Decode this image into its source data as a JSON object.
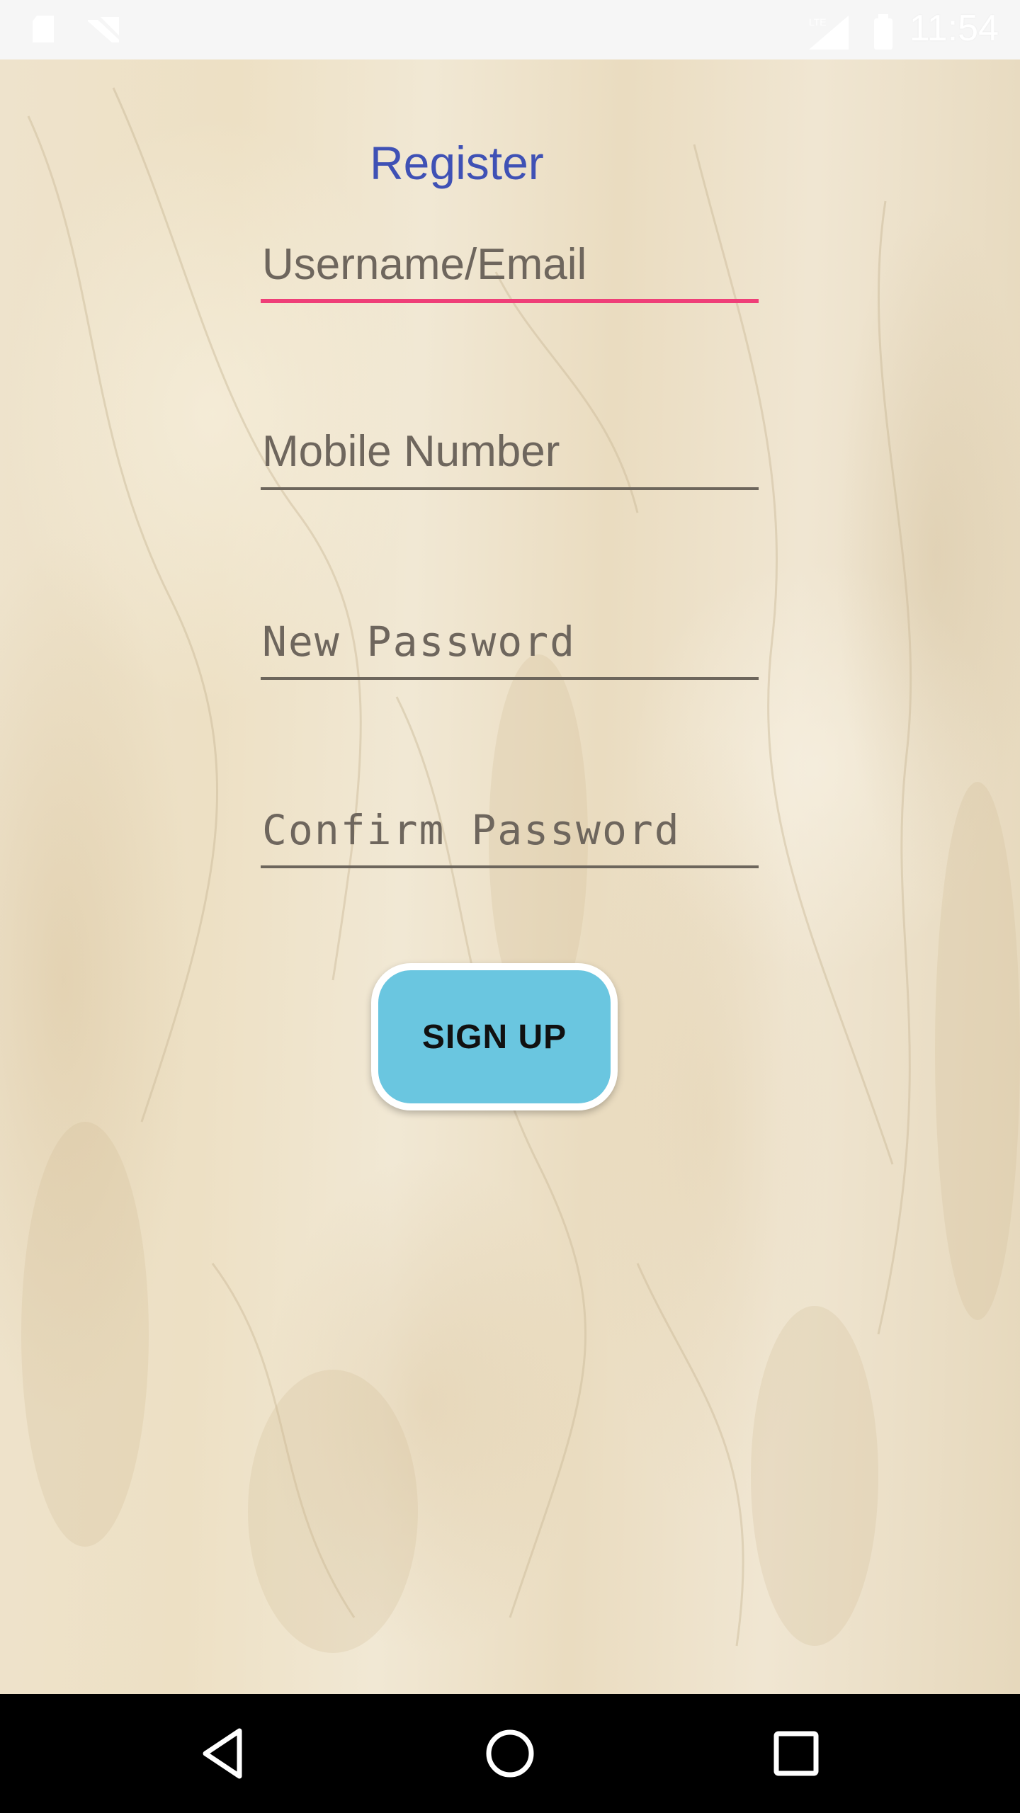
{
  "status_bar": {
    "time": "11:54",
    "network": "LTE",
    "icons": [
      "sd-card-icon",
      "no-sim-icon",
      "signal-icon",
      "battery-icon"
    ]
  },
  "form": {
    "title": "Register",
    "fields": [
      {
        "placeholder": "Username/Email",
        "value": "",
        "focused": true
      },
      {
        "placeholder": "Mobile Number",
        "value": "",
        "focused": false
      },
      {
        "placeholder": "New Password",
        "value": "",
        "focused": false
      },
      {
        "placeholder": "Confirm Password",
        "value": "",
        "focused": false
      }
    ],
    "submit_label": "SIGN UP"
  },
  "nav_bar": {
    "buttons": [
      "back-icon",
      "home-icon",
      "recents-icon"
    ]
  },
  "colors": {
    "title": "#3f51b5",
    "focus_underline": "#ef3f78",
    "button_fill": "#6ac6e0",
    "button_border": "#ffffff"
  }
}
